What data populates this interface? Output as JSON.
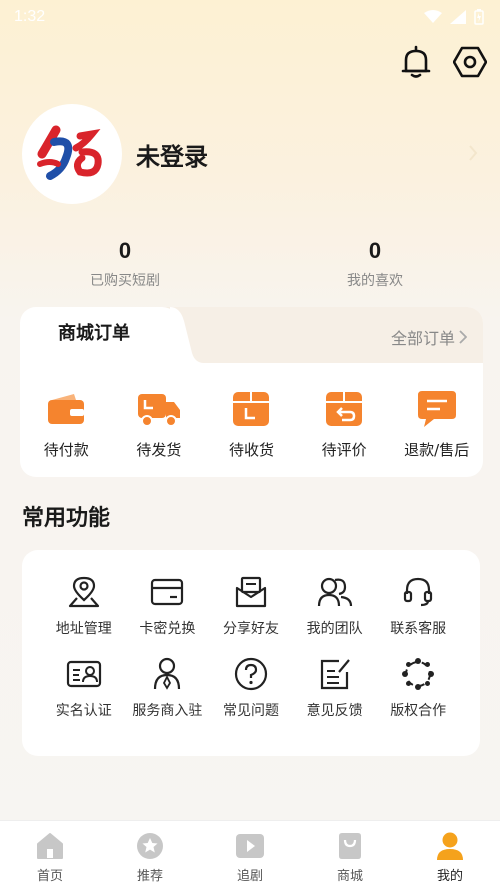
{
  "status_bar": {
    "time": "1:32"
  },
  "profile": {
    "name": "未登录"
  },
  "stats": [
    {
      "value": "0",
      "label": "已购买短剧"
    },
    {
      "value": "0",
      "label": "我的喜欢"
    }
  ],
  "orders": {
    "title": "商城订单",
    "all_label": "全部订单",
    "items": [
      {
        "label": "待付款",
        "icon": "wallet-icon"
      },
      {
        "label": "待发货",
        "icon": "truck-icon"
      },
      {
        "label": "待收货",
        "icon": "box-icon"
      },
      {
        "label": "待评价",
        "icon": "review-box-icon"
      },
      {
        "label": "退款/售后",
        "icon": "refund-chat-icon"
      }
    ]
  },
  "functions": {
    "title": "常用功能",
    "items": [
      {
        "label": "地址管理",
        "icon": "location-icon"
      },
      {
        "label": "卡密兑换",
        "icon": "card-icon"
      },
      {
        "label": "分享好友",
        "icon": "share-envelope-icon"
      },
      {
        "label": "我的团队",
        "icon": "team-icon"
      },
      {
        "label": "联系客服",
        "icon": "headset-icon"
      },
      {
        "label": "实名认证",
        "icon": "id-card-icon"
      },
      {
        "label": "服务商入驻",
        "icon": "provider-icon"
      },
      {
        "label": "常见问题",
        "icon": "question-icon"
      },
      {
        "label": "意见反馈",
        "icon": "feedback-icon"
      },
      {
        "label": "版权合作",
        "icon": "copyright-icon"
      }
    ]
  },
  "tabbar": {
    "items": [
      {
        "label": "首页",
        "icon": "home-icon"
      },
      {
        "label": "推荐",
        "icon": "star-icon"
      },
      {
        "label": "追剧",
        "icon": "play-icon"
      },
      {
        "label": "商城",
        "icon": "shop-bag-icon"
      },
      {
        "label": "我的",
        "icon": "person-icon",
        "active": true
      }
    ]
  },
  "colors": {
    "accent": "#F5842E",
    "tab_active": "#F5A21C",
    "tab_inactive": "#C7C7C7"
  }
}
